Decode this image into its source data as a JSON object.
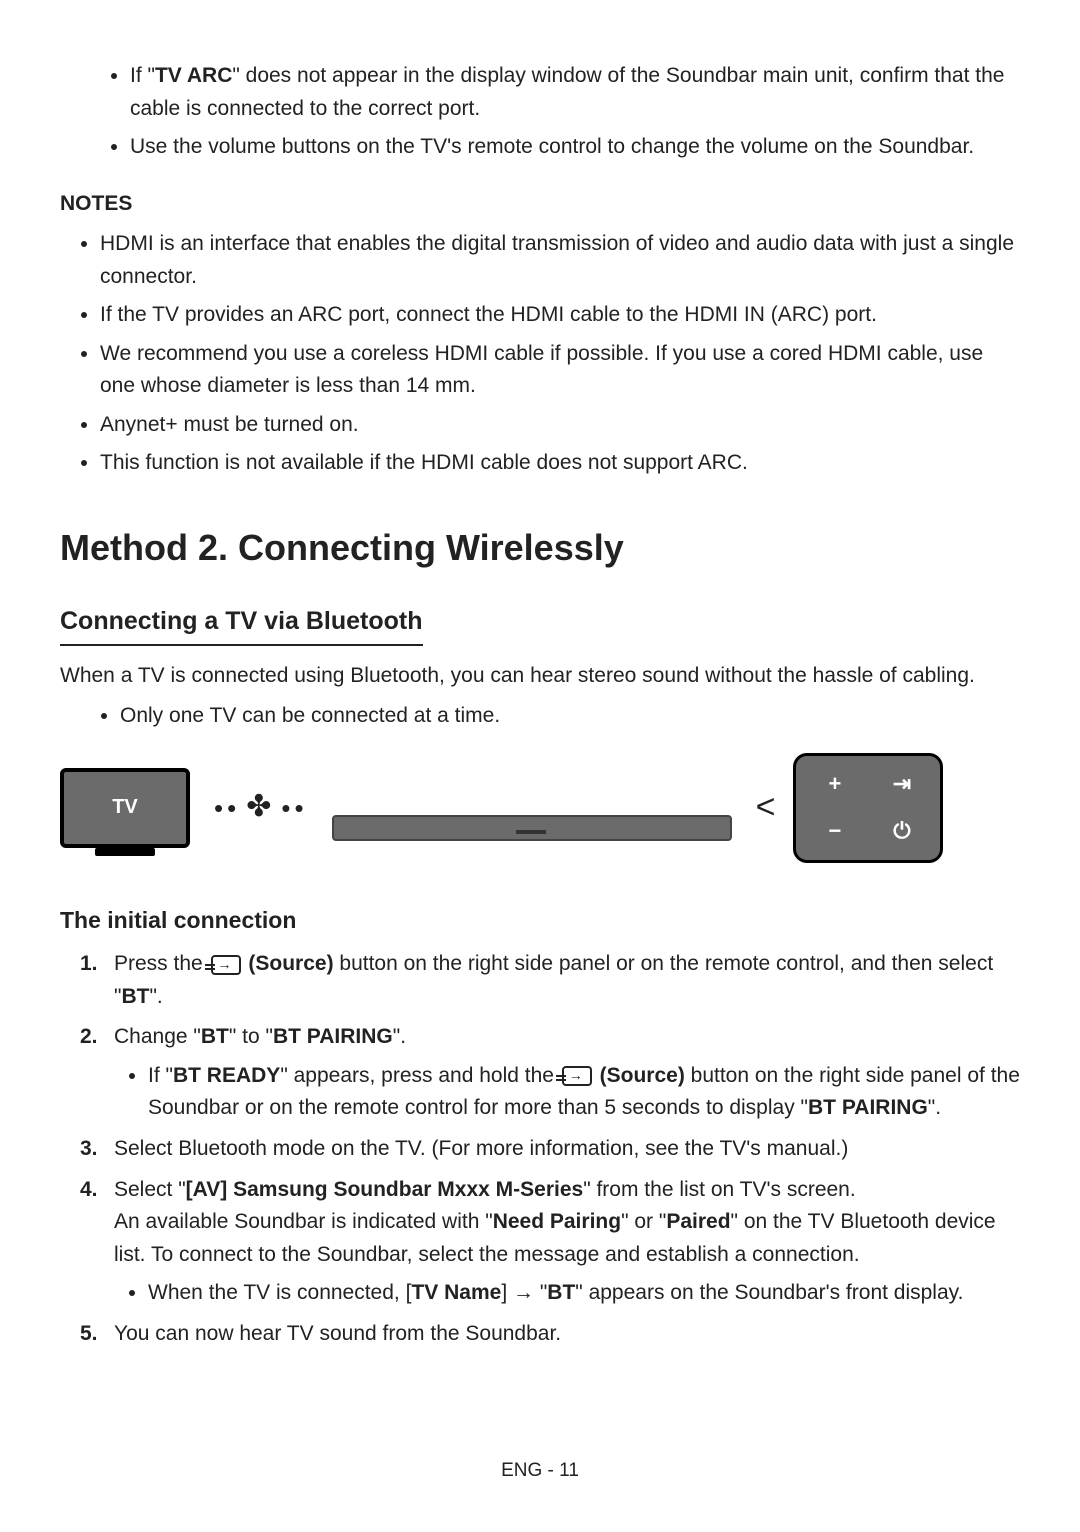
{
  "intro_bullets": [
    {
      "prefix": "If \"",
      "bold": "TV ARC",
      "suffix": "\" does not appear in the display window of the Soundbar main unit, confirm that the cable is connected to the correct port."
    },
    {
      "text": "Use the volume buttons on the TV's remote control to change the volume on the Soundbar."
    }
  ],
  "notes": {
    "heading": "NOTES",
    "items": [
      "HDMI is an interface that enables the digital transmission of video and audio data with just a single connector.",
      "If the TV provides an ARC port, connect the HDMI cable to the HDMI IN (ARC) port.",
      "We recommend you use a coreless HDMI cable if possible. If you use a cored HDMI cable, use one whose diameter is less than 14 mm.",
      "Anynet+ must be turned on.",
      "This function is not available if the HDMI cable does not support ARC."
    ]
  },
  "method_heading": "Method 2. Connecting Wirelessly",
  "bt_section": {
    "heading": "Connecting a TV via Bluetooth",
    "desc": "When a TV is connected using Bluetooth, you can hear stereo sound without the hassle of cabling.",
    "only_one": "Only one TV can be connected at a time."
  },
  "diagram": {
    "tv_label": "TV",
    "bt_left": "••",
    "bt_right": "••",
    "plus": "+",
    "minus": "−",
    "source": "⇥",
    "power": "⏻"
  },
  "initial": {
    "heading": "The initial connection",
    "step1_a": "Press the ",
    "step1_b": " (Source)",
    "step1_c": " button on the right side panel or on the remote control, and then select \"",
    "step1_d": "BT",
    "step1_e": "\".",
    "step2_a": "Change \"",
    "step2_b": "BT",
    "step2_c": "\" to \"",
    "step2_d": "BT PAIRING",
    "step2_e": "\".",
    "step2_sub_a": "If \"",
    "step2_sub_b": "BT READY",
    "step2_sub_c": "\" appears, press and hold the ",
    "step2_sub_d": " (Source)",
    "step2_sub_e": " button on the right side panel of the Soundbar or on the remote control for more than 5 seconds to display \"",
    "step2_sub_f": "BT PAIRING",
    "step2_sub_g": "\".",
    "step3": "Select Bluetooth mode on the TV. (For more information, see the TV's manual.)",
    "step4_a": "Select \"",
    "step4_b": "[AV] Samsung Soundbar Mxxx M-Series",
    "step4_c": "\" from the list on TV's screen.",
    "step4_line2_a": "An available Soundbar is indicated with \"",
    "step4_line2_b": "Need Pairing",
    "step4_line2_c": "\" or \"",
    "step4_line2_d": "Paired",
    "step4_line2_e": "\" on the TV Bluetooth device list. To connect to the Soundbar, select the message and establish a connection.",
    "step4_sub_a": "When the TV is connected, [",
    "step4_sub_b": "TV Name",
    "step4_sub_c": "] → \"",
    "step4_sub_d": "BT",
    "step4_sub_e": "\" appears on the Soundbar's front display.",
    "step5": "You can now hear TV sound from the Soundbar."
  },
  "footer": "ENG - 11"
}
